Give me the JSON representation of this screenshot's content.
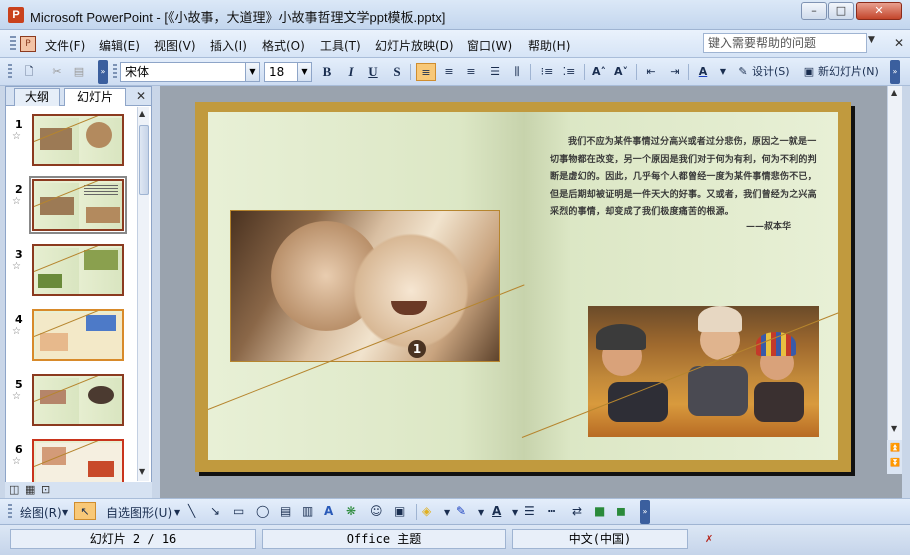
{
  "window": {
    "app_icon": "P",
    "title": "Microsoft PowerPoint - [《小故事，大道理》小故事哲理文学ppt模板.pptx]",
    "minimize": "–",
    "maximize": "□",
    "close": "✕"
  },
  "menu": {
    "items": [
      "文件(F)",
      "编辑(E)",
      "视图(V)",
      "插入(I)",
      "格式(O)",
      "工具(T)",
      "幻灯片放映(D)",
      "窗口(W)",
      "帮助(H)"
    ],
    "help_placeholder": "键入需要帮助的问题"
  },
  "toolbar": {
    "font_name": "宋体",
    "font_size": "18",
    "bold": "B",
    "italic": "I",
    "underline": "U",
    "shadow": "S",
    "design_label": "设计(S)",
    "new_slide_label": "新幻灯片(N)"
  },
  "panel": {
    "tabs": [
      "大纲",
      "幻灯片"
    ],
    "close": "✕",
    "slides": [
      {
        "number": "1"
      },
      {
        "number": "2",
        "selected": true
      },
      {
        "number": "3"
      },
      {
        "number": "4"
      },
      {
        "number": "5"
      },
      {
        "number": "6"
      }
    ]
  },
  "slide": {
    "quote": "我们不应为某件事情过分高兴或者过分悲伤，原因之一就是一切事物都在改变，另一个原因是我们对于何为有利，何为不利的判断是虚幻的。因此，几乎每个人都曾经一度为某件事情悲伤不已，但是后期却被证明是一件天大的好事。又或者，我们曾经为之兴高采烈的事情，却变成了我们极度痛苦的根源。",
    "author": "——叔本华",
    "badge": "1"
  },
  "drawbar": {
    "draw_label": "绘图(R)",
    "autoshapes_label": "自选图形(U)"
  },
  "status": {
    "slide_info": "幻灯片 2 / 16",
    "theme": "Office 主题",
    "language": "中文(中国)"
  }
}
